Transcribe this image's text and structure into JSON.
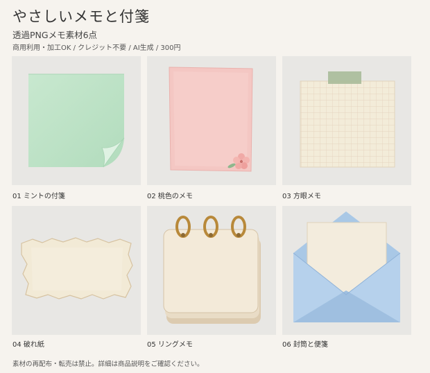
{
  "header": {
    "title": "やさしいメモと付箋",
    "subtitle": "透過PNGメモ素材6点",
    "meta": "商用利用・加工OK / クレジット不要 / AI生成 / 300円"
  },
  "items": [
    {
      "caption": "01 ミントの付箋",
      "icon": "mint-sticky-note-icon"
    },
    {
      "caption": "02 桃色のメモ",
      "icon": "pink-memo-icon"
    },
    {
      "caption": "03 方眼メモ",
      "icon": "grid-memo-icon"
    },
    {
      "caption": "04 破れ紙",
      "icon": "torn-paper-icon"
    },
    {
      "caption": "05 リングメモ",
      "icon": "ring-notepad-icon"
    },
    {
      "caption": "06 封筒と便箋",
      "icon": "envelope-letter-icon"
    }
  ],
  "footer": "素材の再配布・転売は禁止。詳細は商品説明をご確認ください。",
  "colors": {
    "background": "#f6f3ee",
    "card": "#e8e7e4",
    "mint": "#bfe3c8",
    "pink": "#f4c3c0",
    "envelope": "#a9c8e6"
  }
}
